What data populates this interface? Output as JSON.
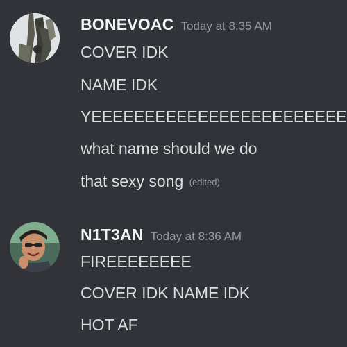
{
  "messages": [
    {
      "author": "BONEVOAC",
      "timestamp": "Today at 8:35 AM",
      "avatar_icon": "user-avatar",
      "lines": [
        "COVER IDK",
        "NAME IDK",
        "YEEEEEEEEEEEEEEEEEEEEEEEE",
        "what name should we do",
        "that sexy song"
      ],
      "edited_label": "(edited)"
    },
    {
      "author": "N1T3AN",
      "timestamp": "Today at 8:36 AM",
      "avatar_icon": "user-avatar",
      "lines": [
        "FIREEEEEEEE",
        "COVER IDK NAME IDK",
        "HOT AF"
      ]
    }
  ],
  "colors": {
    "background": "#313338",
    "username": "#f2f3f5",
    "text": "#dbdee1",
    "muted": "#949ba4"
  }
}
